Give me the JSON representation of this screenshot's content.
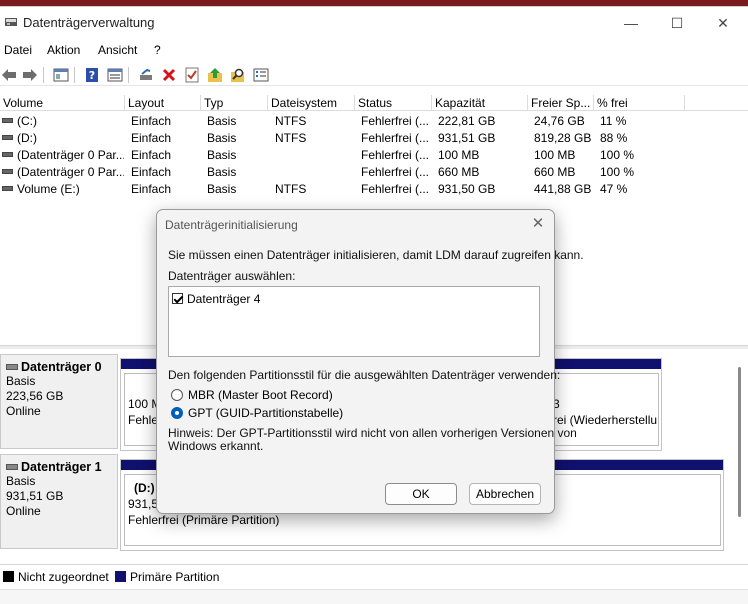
{
  "window": {
    "title": "Datenträgerverwaltung",
    "minimize": "—",
    "maximize": "☐",
    "close": "✕"
  },
  "menu": [
    "Datei",
    "Aktion",
    "Ansicht",
    "?"
  ],
  "toolbar_icons": [
    "back-icon",
    "forward-icon",
    "properties-icon",
    "help-icon",
    "view-icon",
    "connect-icon",
    "delete-icon",
    "check-icon",
    "up-icon",
    "search-icon",
    "list-icon"
  ],
  "volume_table": {
    "columns": [
      "Volume",
      "Layout",
      "Typ",
      "Dateisystem",
      "Status",
      "Kapazität",
      "Freier Sp...",
      "% frei"
    ],
    "rows": [
      [
        "(C:)",
        "Einfach",
        "Basis",
        "NTFS",
        "Fehlerfrei (...",
        "222,81 GB",
        "24,76 GB",
        "11 %"
      ],
      [
        "(D:)",
        "Einfach",
        "Basis",
        "NTFS",
        "Fehlerfrei (...",
        "931,51 GB",
        "819,28 GB",
        "88 %"
      ],
      [
        "(Datenträger 0 Par...",
        "Einfach",
        "Basis",
        "",
        "Fehlerfrei (...",
        "100 MB",
        "100 MB",
        "100 %"
      ],
      [
        "(Datenträger 0 Par...",
        "Einfach",
        "Basis",
        "",
        "Fehlerfrei (...",
        "660 MB",
        "660 MB",
        "100 %"
      ],
      [
        "Volume (E:)",
        "Einfach",
        "Basis",
        "NTFS",
        "Fehlerfrei (...",
        "931,50 GB",
        "441,88 GB",
        "47 %"
      ]
    ]
  },
  "disks": [
    {
      "name": "Datenträger 0",
      "type": "Basis",
      "size": "223,56 GB",
      "state": "Online",
      "part_a_line1": "100 M",
      "part_a_line2": "Fehle",
      "part_b_line1": "3",
      "part_b_line2": "rei (Wiederherstellu"
    },
    {
      "name": "Datenträger 1",
      "type": "Basis",
      "size": "931,51 GB",
      "state": "Online",
      "part_line1": "(D:)",
      "part_line2": "931,5",
      "part_line3": "Fehlerfrei (Primäre Partition)"
    }
  ],
  "legend": [
    {
      "label": "Nicht zugeordnet",
      "color": "#000000"
    },
    {
      "label": "Primäre Partition",
      "color": "#10106e"
    }
  ],
  "dialog": {
    "title": "Datenträgerinitialisierung",
    "close": "✕",
    "intro": "Sie müssen einen Datenträger initialisieren, damit LDM darauf zugreifen kann.",
    "select_label": "Datenträger auswählen:",
    "disk_item": "Datenträger 4",
    "style_label": "Den folgenden Partitionsstil für die ausgewählten Datenträger verwenden:",
    "option_mbr": "MBR (Master Boot Record)",
    "option_gpt": "GPT (GUID-Partitionstabelle)",
    "hint_line1": "Hinweis: Der GPT-Partitionsstil wird nicht von allen vorherigen Versionen von",
    "hint_line2": "Windows erkannt.",
    "ok": "OK",
    "cancel": "Abbrechen"
  }
}
